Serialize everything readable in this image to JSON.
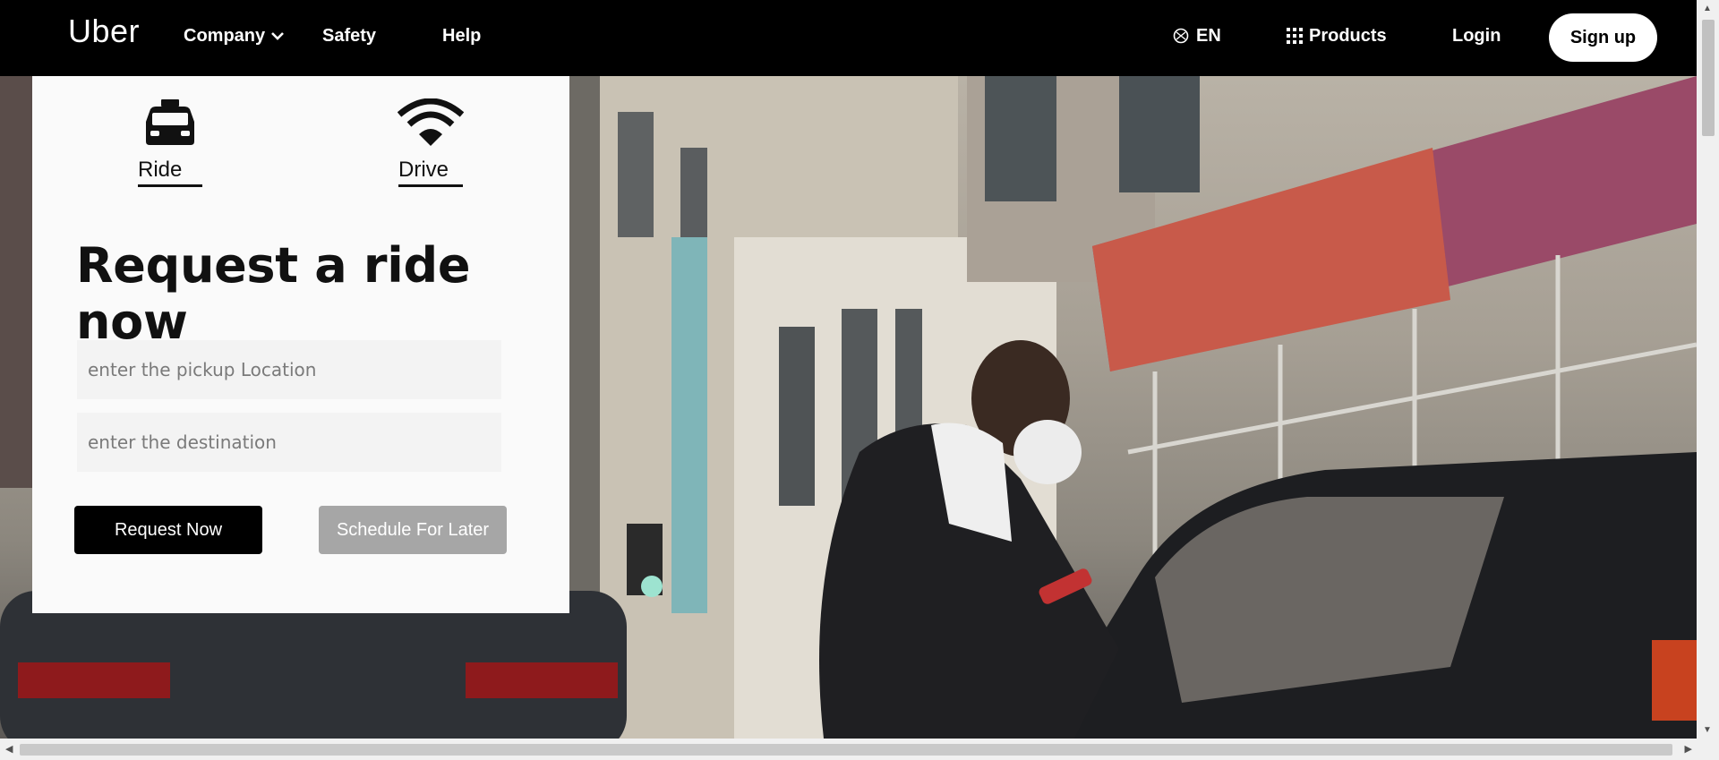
{
  "nav": {
    "logo": "Uber",
    "company": "Company",
    "safety": "Safety",
    "help": "Help",
    "language": "EN",
    "products": "Products",
    "login": "Login",
    "signup": "Sign up"
  },
  "card": {
    "modes": [
      {
        "label": "Ride",
        "icon": "taxi-icon"
      },
      {
        "label": "Drive",
        "icon": "wifi-icon"
      }
    ],
    "title": "Request a ride now",
    "pickup_placeholder": "enter the pickup Location",
    "destination_placeholder": "enter the destination",
    "request_button": "Request Now",
    "schedule_button": "Schedule For Later"
  },
  "colors": {
    "nav_bg": "#000000",
    "primary_button": "#000000",
    "disabled_button": "#a6a6a6"
  }
}
